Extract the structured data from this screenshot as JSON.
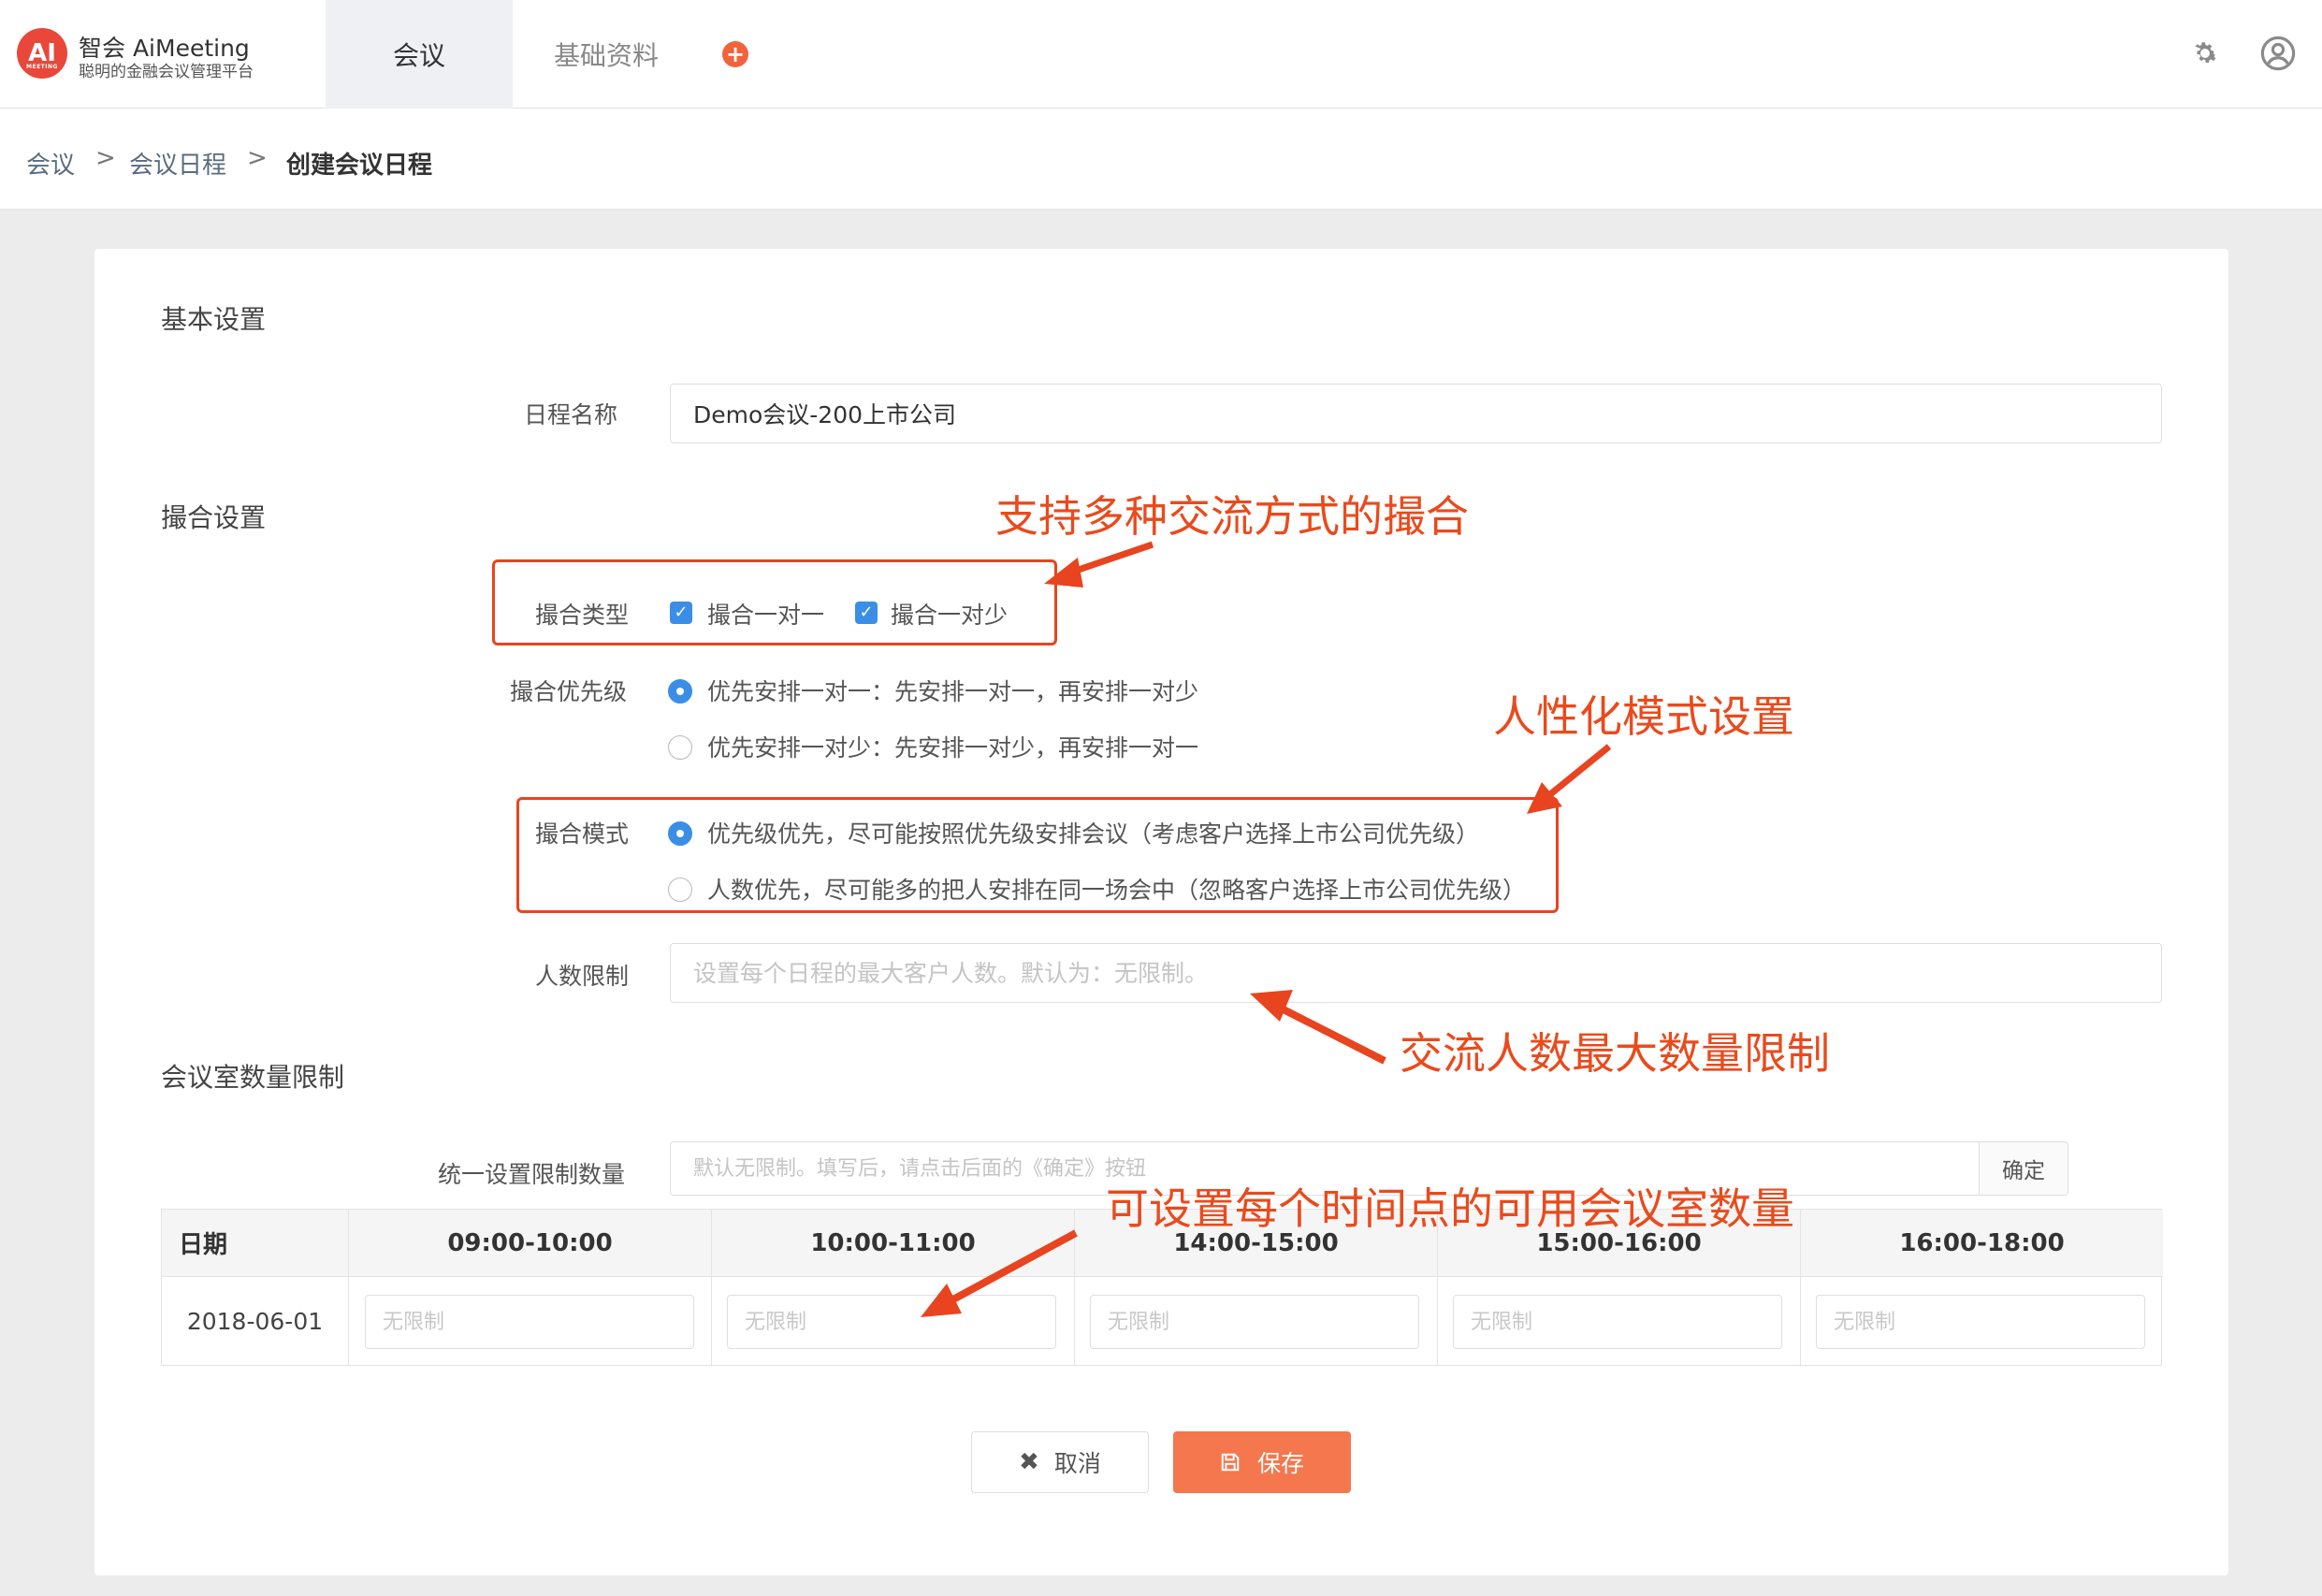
{
  "app": {
    "logo_text": "AI",
    "logo_mark_small": "MEETING",
    "title": "智会 AiMeeting",
    "subtitle": "聪明的金融会议管理平台"
  },
  "nav": {
    "tabs": [
      {
        "label": "会议",
        "active": true
      },
      {
        "label": "基础资料",
        "active": false
      }
    ],
    "add_icon": "plus-circle-icon",
    "settings_icon": "gear-icon",
    "user_icon": "user-icon"
  },
  "breadcrumb": {
    "items": [
      "会议",
      "会议日程",
      "创建会议日程"
    ],
    "separator": ">"
  },
  "form": {
    "basic_section": "基本设置",
    "name_label": "日程名称",
    "name_value": "Demo会议-200上市公司",
    "match_section": "撮合设置",
    "match_type_label": "撮合类型",
    "match_type_options": [
      {
        "label": "撮合一对一",
        "checked": true
      },
      {
        "label": "撮合一对少",
        "checked": true
      }
    ],
    "priority_label": "撮合优先级",
    "priority_options": [
      {
        "label": "优先安排一对一：先安排一对一，再安排一对少",
        "selected": true
      },
      {
        "label": "优先安排一对少：先安排一对少，再安排一对一",
        "selected": false
      }
    ],
    "mode_label": "撮合模式",
    "mode_options": [
      {
        "label": "优先级优先，尽可能按照优先级安排会议（考虑客户选择上市公司优先级）",
        "selected": true
      },
      {
        "label": "人数优先，尽可能多的把人安排在同一场会中（忽略客户选择上市公司优先级）",
        "selected": false
      }
    ],
    "limit_label": "人数限制",
    "limit_placeholder": "设置每个日程的最大客户人数。默认为：无限制。",
    "room_section": "会议室数量限制",
    "unified_label": "统一设置限制数量",
    "unified_placeholder": "默认无限制。填写后，请点击后面的《确定》按钮",
    "confirm_label": "确定",
    "table": {
      "headers": [
        "日期",
        "09:00-10:00",
        "10:00-11:00",
        "14:00-15:00",
        "15:00-16:00",
        "16:00-18:00"
      ],
      "rows": [
        {
          "date": "2018-06-01",
          "placeholders": [
            "无限制",
            "无限制",
            "无限制",
            "无限制",
            "无限制"
          ]
        }
      ]
    },
    "cancel_label": "取消",
    "save_label": "保存"
  },
  "annotations": {
    "match_methods": "支持多种交流方式的撮合",
    "mode_setting": "人性化模式设置",
    "people_limit": "交流人数最大数量限制",
    "room_count": "可设置每个时间点的可用会议室数量",
    "color": "#e8441f"
  },
  "colors": {
    "accent": "#3a8ee6",
    "brand": "#e8473a",
    "save": "#f4774d"
  }
}
